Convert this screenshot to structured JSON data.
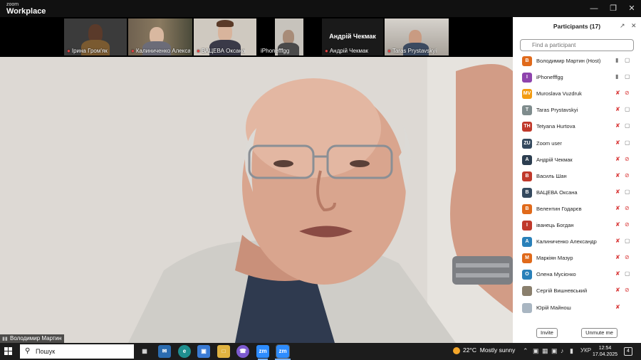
{
  "app": {
    "brand_small": "zoom",
    "brand_large": "Workplace",
    "minimize_icon": "minimize-icon",
    "restore_icon": "restore-icon",
    "close_icon": "close-icon"
  },
  "thumbnails": [
    {
      "name": "Ірина Гром'як",
      "muted": true
    },
    {
      "name": "Калиниченко Алекса...",
      "muted": true
    },
    {
      "name": "ВАЦЕВА Оксана",
      "muted": true
    },
    {
      "name": "iPhonefffgg",
      "muted": false
    },
    {
      "name": "Андрій Чекмак",
      "muted": true,
      "display_name": "Андрій Чекмак"
    },
    {
      "name": "Taras Prystavskyi",
      "muted": true
    }
  ],
  "main_video": {
    "speaker_name": "Володимир Мартин"
  },
  "participants_panel": {
    "title": "Participants (17)",
    "search_placeholder": "Find a participant",
    "participants": [
      {
        "initials": "В",
        "name": "Володимир Мартин (Host)",
        "color": "#e06a1b",
        "mic": "on",
        "cam": "on"
      },
      {
        "initials": "I",
        "name": "iPhonefffgg",
        "color": "#8e44ad",
        "mic": "on",
        "cam": "on"
      },
      {
        "initials": "MV",
        "name": "Muroslava Vuzdruk",
        "color": "#f39c12",
        "mic": "off",
        "cam": "off"
      },
      {
        "initials": "T",
        "name": "Taras Prystavskyi",
        "color": "#7f8c8d",
        "mic": "off",
        "cam": "on"
      },
      {
        "initials": "TH",
        "name": "Tetyana Hurtova",
        "color": "#c0392b",
        "mic": "off",
        "cam": "on"
      },
      {
        "initials": "ZU",
        "name": "Zoom user",
        "color": "#34495e",
        "mic": "off",
        "cam": "on"
      },
      {
        "initials": "А",
        "name": "Андрій Чекмак",
        "color": "#2c3e50",
        "mic": "off",
        "cam": "off"
      },
      {
        "initials": "В",
        "name": "Василь Шан",
        "color": "#c0392b",
        "mic": "off",
        "cam": "off"
      },
      {
        "initials": "В",
        "name": "ВАЦЕВА Оксана",
        "color": "#34495e",
        "mic": "off",
        "cam": "on"
      },
      {
        "initials": "В",
        "name": "Велентин Годарєв",
        "color": "#e06a1b",
        "mic": "off",
        "cam": "off"
      },
      {
        "initials": "І",
        "name": "іванець Богдан",
        "color": "#c0392b",
        "mic": "off",
        "cam": "off"
      },
      {
        "initials": "А",
        "name": "Калиниченко Александр",
        "color": "#2980b9",
        "mic": "off",
        "cam": "on"
      },
      {
        "initials": "М",
        "name": "Маркіян Мазур",
        "color": "#e06a1b",
        "mic": "off",
        "cam": "off"
      },
      {
        "initials": "О",
        "name": "Олена Мусієнко",
        "color": "#2980b9",
        "mic": "off",
        "cam": "on"
      },
      {
        "initials": "",
        "name": "Сергій Вишневський",
        "color": "#8a7f6d",
        "mic": "off",
        "cam": "off"
      },
      {
        "initials": "",
        "name": "Юрій Майнош",
        "color": "#a9b6c2",
        "mic": "off",
        "cam": "none"
      }
    ],
    "invite_label": "Invite",
    "unmute_label": "Unmute me"
  },
  "taskbar": {
    "search_label": "Пошук",
    "apps": [
      "task-view",
      "mail",
      "edge",
      "store",
      "file-explorer",
      "viber",
      "zoom",
      "zoom-workplace"
    ],
    "weather_temp": "22°C",
    "weather_text": "Mostly sunny",
    "language": "УКР",
    "time": "12:54",
    "date": "17.04.2025",
    "notifications": "4"
  }
}
